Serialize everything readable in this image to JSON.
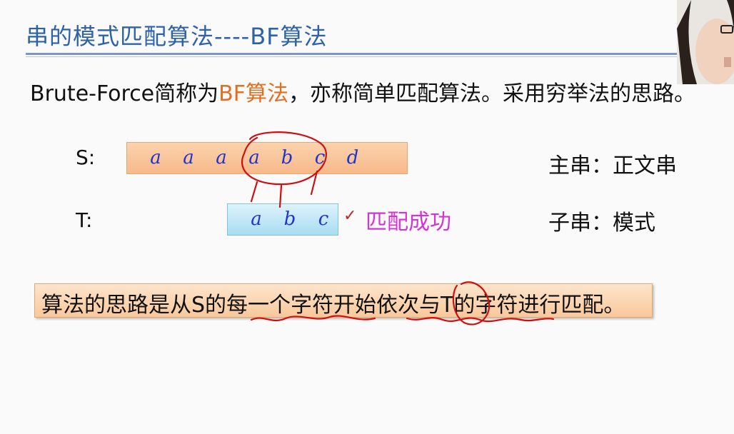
{
  "slide": {
    "title": "串的模式匹配算法----BF算法",
    "intro": {
      "part1": "Brute-Force简称为",
      "highlight": "BF算法",
      "part2": "，亦称简单匹配算法。采用穷举法的思路。"
    },
    "main_string": {
      "label": "S:",
      "chars": [
        "a",
        "a",
        "a",
        "a",
        "b",
        "c",
        "d"
      ]
    },
    "pattern": {
      "label": "T:",
      "chars": [
        "a",
        "b",
        "c"
      ],
      "check_mark": "✓",
      "result": "匹配成功"
    },
    "right_notes": {
      "main": "主串：正文串",
      "sub": "子串：模式"
    },
    "note": "算法的思路是从S的每一个字符开始依次与T的字符进行匹配。"
  },
  "colors": {
    "title": "#2e62a8",
    "highlight": "#e07020",
    "chars": "#2233cc",
    "success": "#d633d6",
    "ink": "#cc1111",
    "box_s": "#f7b98a",
    "box_t": "#a9dcf1"
  }
}
